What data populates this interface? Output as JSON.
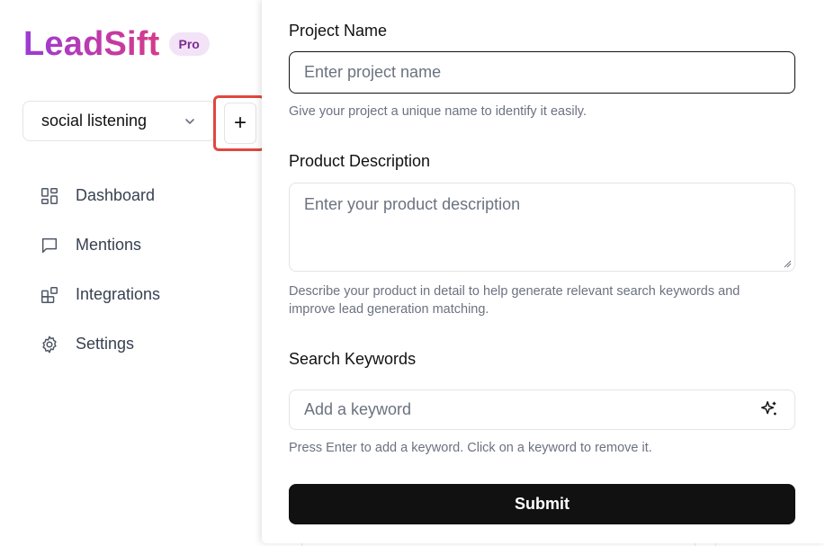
{
  "brand": {
    "name": "LeadSift",
    "badge": "Pro"
  },
  "sidebar": {
    "project_select": {
      "value": "social listening",
      "icon": "chevron-down-icon"
    },
    "add_button": {
      "label": "+"
    },
    "nav": [
      {
        "label": "Dashboard",
        "icon": "dashboard-icon"
      },
      {
        "label": "Mentions",
        "icon": "message-icon"
      },
      {
        "label": "Integrations",
        "icon": "integrations-icon"
      },
      {
        "label": "Settings",
        "icon": "gear-icon"
      }
    ]
  },
  "form": {
    "project_name": {
      "label": "Project Name",
      "placeholder": "Enter project name",
      "help": "Give your project a unique name to identify it easily."
    },
    "product_description": {
      "label": "Product Description",
      "placeholder": "Enter your product description",
      "help": "Describe your product in detail to help generate relevant search keywords and improve lead generation matching."
    },
    "search_keywords": {
      "label": "Search Keywords",
      "placeholder": "Add a keyword",
      "help": "Press Enter to add a keyword. Click on a keyword to remove it.",
      "icon": "sparkle-icon"
    },
    "submit_label": "Submit"
  },
  "colors": {
    "accent_gradient_start": "#9b3bd6",
    "accent_gradient_end": "#d43c8a",
    "badge_bg": "#f3e3f7",
    "highlight_border": "#e0483f",
    "primary_button": "#111111"
  }
}
